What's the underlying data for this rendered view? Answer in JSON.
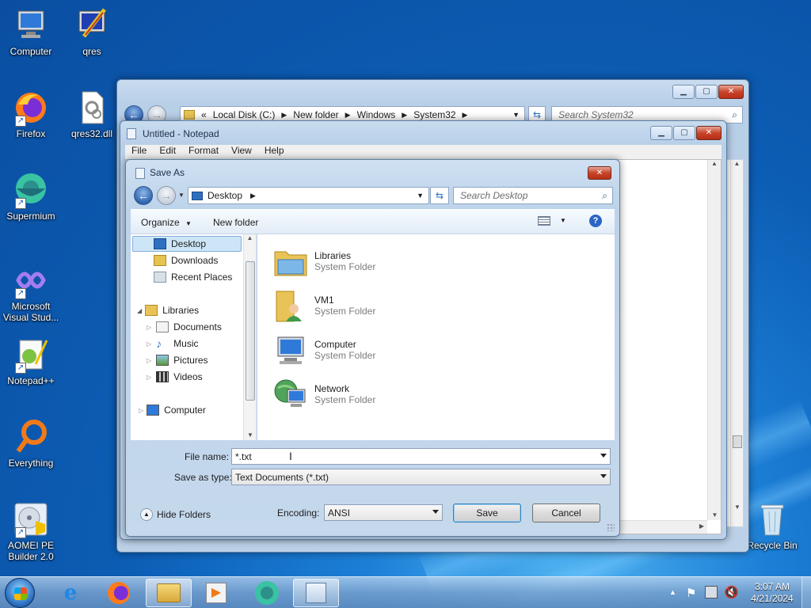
{
  "desktop": {
    "icons": [
      {
        "label": "Computer"
      },
      {
        "label": "qres"
      },
      {
        "label": "Firefox"
      },
      {
        "label": "qres32.dll"
      },
      {
        "label": "Supermium"
      },
      {
        "label": "Microsoft Visual Stud..."
      },
      {
        "label": "Notepad++"
      },
      {
        "label": "Everything"
      },
      {
        "label": "AOMEI PE Builder 2.0"
      },
      {
        "label": "Recycle Bin"
      }
    ]
  },
  "explorer": {
    "breadcrumb": [
      "Local Disk (C:)",
      "New folder",
      "Windows",
      "System32"
    ],
    "search_placeholder": "Search System32"
  },
  "notepad": {
    "title": "Untitled - Notepad",
    "menu": [
      "File",
      "Edit",
      "Format",
      "View",
      "Help"
    ]
  },
  "save_as": {
    "title": "Save As",
    "location": "Desktop",
    "search_placeholder": "Search Desktop",
    "toolbar": {
      "organize": "Organize",
      "new_folder": "New folder"
    },
    "nav": {
      "desktop": "Desktop",
      "downloads": "Downloads",
      "recent": "Recent Places",
      "libraries": "Libraries",
      "documents": "Documents",
      "music": "Music",
      "pictures": "Pictures",
      "videos": "Videos",
      "computer": "Computer"
    },
    "items": [
      {
        "name": "Libraries",
        "type": "System Folder"
      },
      {
        "name": "VM1",
        "type": "System Folder"
      },
      {
        "name": "Computer",
        "type": "System Folder"
      },
      {
        "name": "Network",
        "type": "System Folder"
      }
    ],
    "file_name_label": "File name:",
    "file_name_value": "*.txt",
    "save_type_label": "Save as type:",
    "save_type_value": "Text Documents (*.txt)",
    "hide_folders": "Hide Folders",
    "encoding_label": "Encoding:",
    "encoding_value": "ANSI",
    "save_button": "Save",
    "cancel_button": "Cancel"
  },
  "taskbar": {
    "time": "3:07 AM",
    "date": "4/21/2024"
  },
  "colors": {
    "accent": "#3c7fb1",
    "close": "#c7452b",
    "selection": "#cde6f7"
  }
}
